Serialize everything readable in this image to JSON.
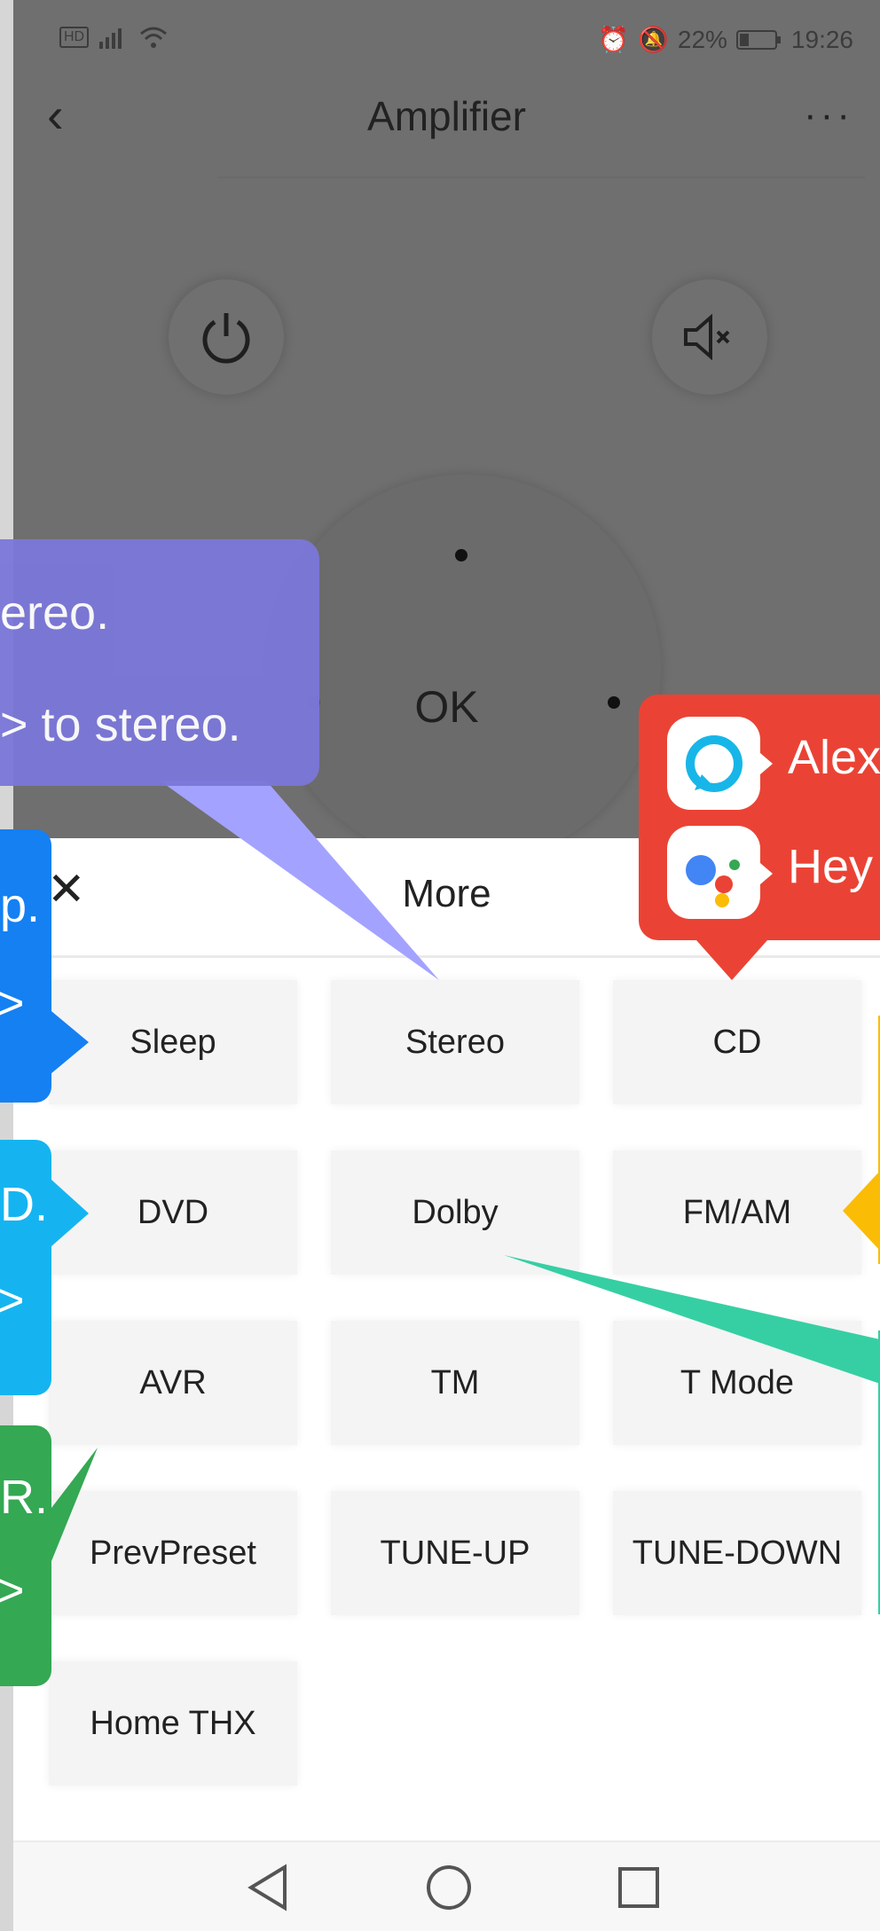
{
  "status_bar": {
    "left_icons": [
      "hd-icon",
      "signal-icon",
      "wifi-icon"
    ],
    "left_text": "HD ⁴⁶.ıl",
    "battery": "22%",
    "time": "19:26"
  },
  "header": {
    "title": "Amplifier"
  },
  "remote": {
    "ok_label": "OK"
  },
  "sheet": {
    "title": "More",
    "keys": [
      "Sleep",
      "Stereo",
      "CD",
      "DVD",
      "Dolby",
      "FM/AM",
      "AVR",
      "TM",
      "T Mode",
      "PrevPreset",
      "TUNE-UP",
      "TUNE-DOWN",
      "Home THX"
    ]
  },
  "callouts": {
    "stereo_line1": "ereo.",
    "stereo_line2": "> to stereo.",
    "sleep_line1": "p.",
    "sleep_line2": ">",
    "dvd_line1": "D.",
    "dvd_line2": ">",
    "avr_line1": "R.",
    "avr_line2": ">",
    "alexa_text": "Alex",
    "google_text": "Hey"
  },
  "colors": {
    "purple": "#7b77d9",
    "blue": "#1480f2",
    "cyan": "#15b4f0",
    "green": "#34a853",
    "red": "#ea4335",
    "orange": "#fbbc05",
    "teal": "#36cfa3"
  }
}
